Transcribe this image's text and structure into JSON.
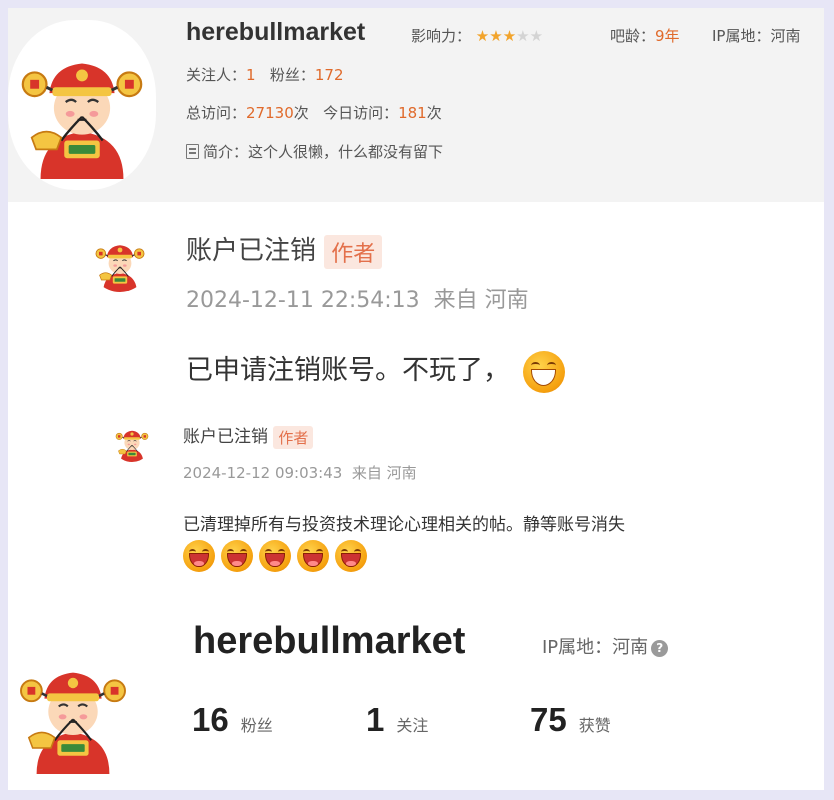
{
  "profile": {
    "username": "herebullmarket",
    "influence_label": "影响力：",
    "influence_stars": 3,
    "influence_max": 5,
    "bar_age_label": "吧龄：",
    "bar_age_value": "9年",
    "ip_label": "IP属地：",
    "ip_value": "河南",
    "following_label": "关注人：",
    "following_value": "1",
    "fans_label": "粉丝：",
    "fans_value": "172",
    "total_visits_label": "总访问：",
    "total_visits_value": "27130",
    "visits_unit": "次",
    "today_visits_label": "今日访问：",
    "today_visits_value": "181",
    "bio_label": "简介：",
    "bio_text": "这个人很懒，什么都没有留下"
  },
  "comment": {
    "user": "账户已注销",
    "badge": "作者",
    "time": "2024-12-11 22:54:13",
    "location": "来自 河南",
    "text": "已申请注销账号。不玩了，",
    "emoji": "grin-emoji"
  },
  "reply": {
    "user": "账户已注销",
    "badge": "作者",
    "time": "2024-12-12 09:03:43",
    "location": "来自 河南",
    "text": "已清理掉所有与投资技术理论心理相关的帖。静等账号消失",
    "emoji_count": 5,
    "emoji": "laugh-emoji"
  },
  "bottom_profile": {
    "username": "herebullmarket",
    "ip_text": "IP属地：河南",
    "help_icon": "question-icon",
    "stats": [
      {
        "value": "16",
        "label": "粉丝"
      },
      {
        "value": "1",
        "label": "关注"
      },
      {
        "value": "75",
        "label": "获赞"
      }
    ]
  },
  "colors": {
    "accent_orange": "#e06a2b",
    "badge_bg": "#fbe7df",
    "badge_text": "#e3704b",
    "star_on": "#f2a42c",
    "star_off": "#d4d4d4"
  }
}
